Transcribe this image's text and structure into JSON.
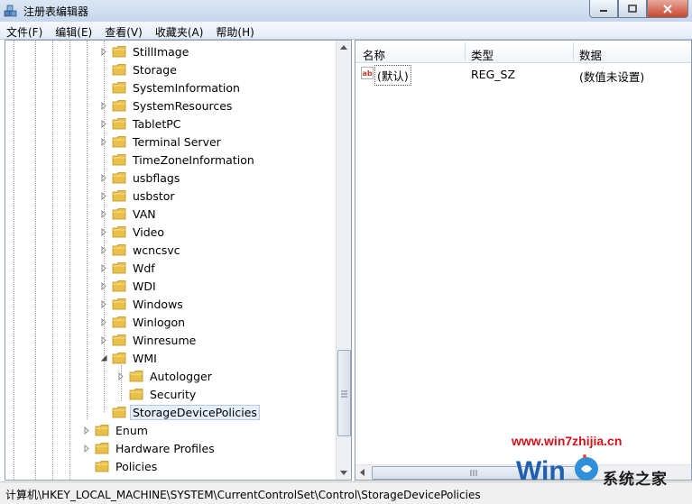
{
  "window": {
    "title": "注册表编辑器",
    "icon": "regedit-icon",
    "controls": [
      "minimize",
      "maximize",
      "close"
    ]
  },
  "menu": [
    "文件(F)",
    "编辑(E)",
    "查看(V)",
    "收藏夹(A)",
    "帮助(H)"
  ],
  "tree": {
    "items": [
      {
        "label": "StillImage",
        "level": 1,
        "expander": "collapsed"
      },
      {
        "label": "Storage",
        "level": 1,
        "expander": "none"
      },
      {
        "label": "SystemInformation",
        "level": 1,
        "expander": "none"
      },
      {
        "label": "SystemResources",
        "level": 1,
        "expander": "collapsed"
      },
      {
        "label": "TabletPC",
        "level": 1,
        "expander": "collapsed"
      },
      {
        "label": "Terminal Server",
        "level": 1,
        "expander": "collapsed"
      },
      {
        "label": "TimeZoneInformation",
        "level": 1,
        "expander": "none"
      },
      {
        "label": "usbflags",
        "level": 1,
        "expander": "collapsed"
      },
      {
        "label": "usbstor",
        "level": 1,
        "expander": "collapsed"
      },
      {
        "label": "VAN",
        "level": 1,
        "expander": "collapsed"
      },
      {
        "label": "Video",
        "level": 1,
        "expander": "collapsed"
      },
      {
        "label": "wcncsvc",
        "level": 1,
        "expander": "collapsed"
      },
      {
        "label": "Wdf",
        "level": 1,
        "expander": "collapsed"
      },
      {
        "label": "WDI",
        "level": 1,
        "expander": "collapsed"
      },
      {
        "label": "Windows",
        "level": 1,
        "expander": "collapsed"
      },
      {
        "label": "Winlogon",
        "level": 1,
        "expander": "collapsed"
      },
      {
        "label": "Winresume",
        "level": 1,
        "expander": "collapsed"
      },
      {
        "label": "WMI",
        "level": 1,
        "expander": "expanded"
      },
      {
        "label": "Autologger",
        "level": 2,
        "expander": "collapsed"
      },
      {
        "label": "Security",
        "level": 2,
        "expander": "none"
      },
      {
        "label": "StorageDevicePolicies",
        "level": 1,
        "expander": "none",
        "selected": true
      },
      {
        "label": "Enum",
        "level": 0,
        "expander": "collapsed"
      },
      {
        "label": "Hardware Profiles",
        "level": 0,
        "expander": "collapsed"
      },
      {
        "label": "Policies",
        "level": 0,
        "expander": "none"
      }
    ]
  },
  "list": {
    "columns": [
      "名称",
      "类型",
      "数据"
    ],
    "rows": [
      {
        "name": "(默认)",
        "type": "REG_SZ",
        "data": "(数值未设置)",
        "icon": "string-value-icon"
      }
    ]
  },
  "status": "计算机\\HKEY_LOCAL_MACHINE\\SYSTEM\\CurrentControlSet\\Control\\StorageDevicePolicies",
  "watermark": {
    "url": "www.win7zhijia.cn",
    "brand": "系统之家"
  },
  "colors": {
    "folder": "#e8c04a",
    "selection": "#e5eefa",
    "watermark_red": "#d2121b"
  }
}
